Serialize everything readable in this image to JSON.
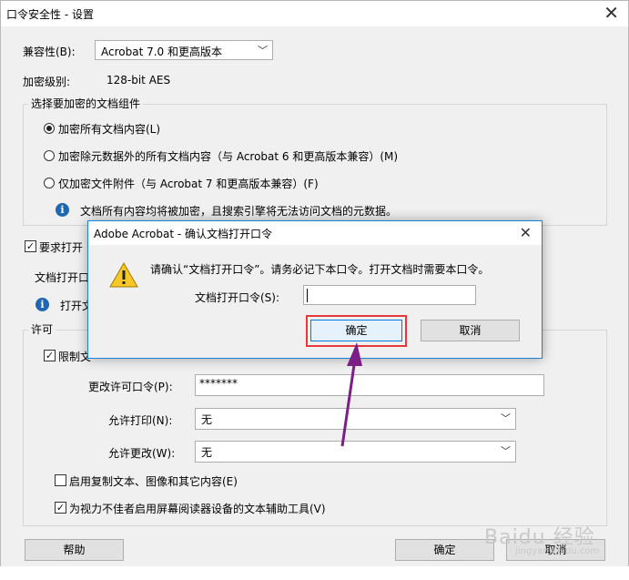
{
  "window": {
    "title": "口令安全性 - 设置"
  },
  "compat": {
    "label": "兼容性(B):",
    "value": "Acrobat 7.0 和更高版本"
  },
  "encryption_level": {
    "label": "加密级别:",
    "value": "128-bit AES"
  },
  "components": {
    "title": "选择要加密的文档组件",
    "options": [
      {
        "label": "加密所有文档内容(L)",
        "selected": true
      },
      {
        "label": "加密除元数据外的所有文档内容（与 Acrobat 6 和更高版本兼容）(M)",
        "selected": false
      },
      {
        "label": "仅加密文件附件（与 Acrobat 7 和更高版本兼容）(F)",
        "selected": false
      }
    ],
    "note": "文档所有内容均将被加密，且搜索引擎将无法访问文档的元数据。"
  },
  "open_password": {
    "require_label": "要求打开",
    "field_label": "文档打开口",
    "info_text": "打开文"
  },
  "permissions": {
    "title": "许可",
    "restrict_label": "限制文",
    "change_pw_label": "更改许可口令(P):",
    "change_pw_value": "*******",
    "print_label": "允许打印(N):",
    "print_value": "无",
    "change_label": "允许更改(W):",
    "change_value": "无",
    "copy_label": "启用复制文本、图像和其它内容(E)",
    "accessibility_label": "为视力不佳者启用屏幕阅读器设备的文本辅助工具(V)"
  },
  "footer": {
    "help": "帮助",
    "ok": "确定",
    "cancel": "取消"
  },
  "dialog": {
    "title": "Adobe Acrobat - 确认文档打开口令",
    "message": "请确认“文档打开口令”。请务必记下本口令。打开文档时需要本口令。",
    "field_label": "文档打开口令(S):",
    "field_value": "",
    "ok": "确定",
    "cancel": "取消"
  },
  "watermark": {
    "text": "Baidu 经验",
    "url": "jingyan.baidu.com"
  },
  "colors": {
    "highlight": "#e33b3b",
    "arrow": "#7b1e85",
    "dialog_border": "#1883d7",
    "accent": "#1f67b1"
  }
}
